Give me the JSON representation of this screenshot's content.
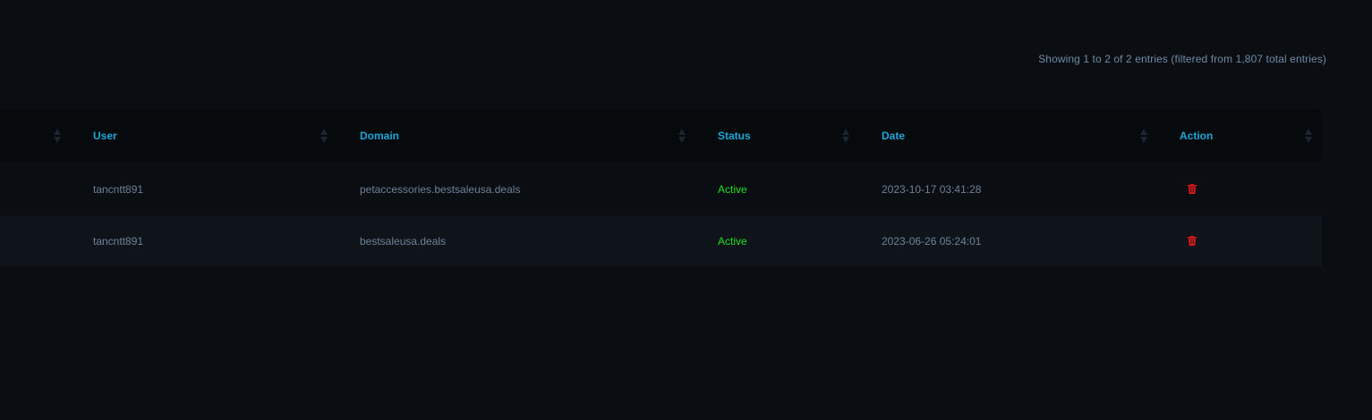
{
  "info_text": "Showing 1 to 2 of 2 entries (filtered from 1,807 total entries)",
  "columns": {
    "user": "User",
    "domain": "Domain",
    "status": "Status",
    "date": "Date",
    "action": "Action"
  },
  "rows": [
    {
      "user": "tancntt891",
      "domain": "petaccessories.bestsaleusa.deals",
      "status": "Active",
      "date": "2023-10-17 03:41:28",
      "action_icon": "trash-icon"
    },
    {
      "user": "tancntt891",
      "domain": "bestsaleusa.deals",
      "status": "Active",
      "date": "2023-06-26 05:24:01",
      "action_icon": "trash-icon"
    }
  ],
  "colors": {
    "header_text": "#1aa7d8",
    "status_active": "#19e01e",
    "delete_icon": "#e01919",
    "body_text": "#6d8196"
  }
}
